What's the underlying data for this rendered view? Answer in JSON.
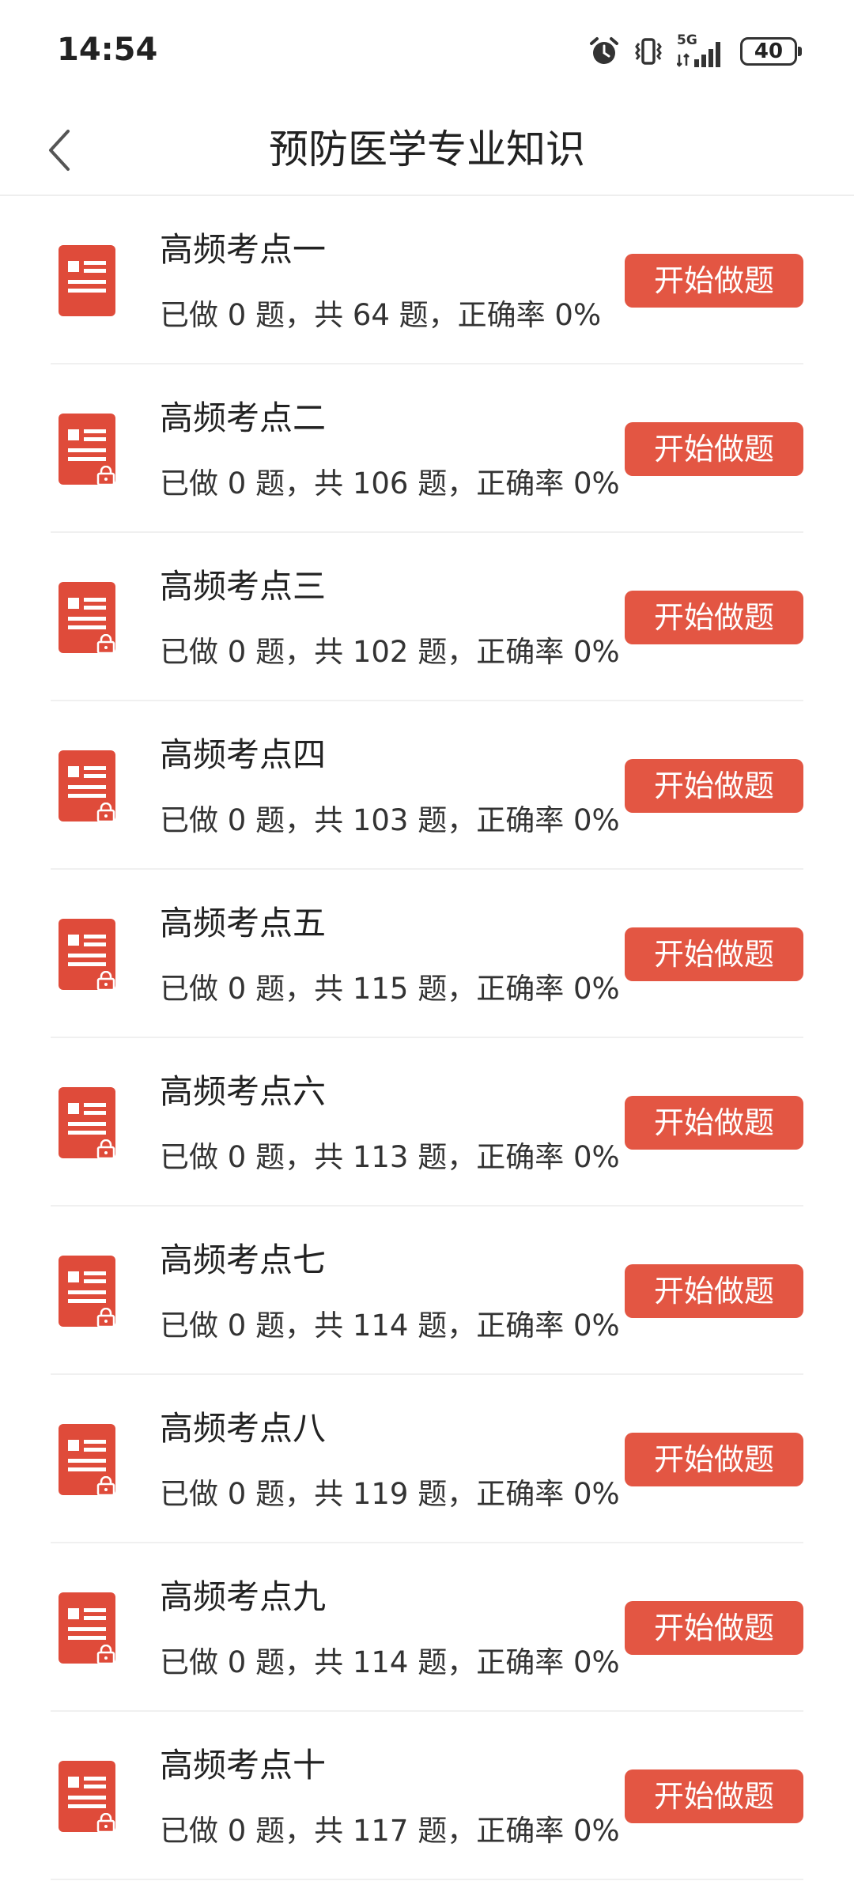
{
  "status_bar": {
    "time": "14:54",
    "network": "5G",
    "battery": "40",
    "icons": [
      "alarm-icon",
      "vibrate-icon",
      "signal-5g-icon",
      "battery-icon"
    ]
  },
  "header": {
    "title": "预防医学专业知识",
    "back_icon": "chevron-left-icon"
  },
  "colors": {
    "accent": "#e35643",
    "icon_red": "#df4b3a",
    "divider": "#f0f0f0"
  },
  "items": [
    {
      "title": "高频考点一",
      "stats": "已做 0 题，共 64 题，正确率 0%",
      "button": "开始做题",
      "locked": false
    },
    {
      "title": "高频考点二",
      "stats": "已做 0 题，共 106 题，正确率 0%",
      "button": "开始做题",
      "locked": true
    },
    {
      "title": "高频考点三",
      "stats": "已做 0 题，共 102 题，正确率 0%",
      "button": "开始做题",
      "locked": true
    },
    {
      "title": "高频考点四",
      "stats": "已做 0 题，共 103 题，正确率 0%",
      "button": "开始做题",
      "locked": true
    },
    {
      "title": "高频考点五",
      "stats": "已做 0 题，共 115 题，正确率 0%",
      "button": "开始做题",
      "locked": true
    },
    {
      "title": "高频考点六",
      "stats": "已做 0 题，共 113 题，正确率 0%",
      "button": "开始做题",
      "locked": true
    },
    {
      "title": "高频考点七",
      "stats": "已做 0 题，共 114 题，正确率 0%",
      "button": "开始做题",
      "locked": true
    },
    {
      "title": "高频考点八",
      "stats": "已做 0 题，共 119 题，正确率 0%",
      "button": "开始做题",
      "locked": true
    },
    {
      "title": "高频考点九",
      "stats": "已做 0 题，共 114 题，正确率 0%",
      "button": "开始做题",
      "locked": true
    },
    {
      "title": "高频考点十",
      "stats": "已做 0 题，共 117 题，正确率 0%",
      "button": "开始做题",
      "locked": true
    }
  ]
}
